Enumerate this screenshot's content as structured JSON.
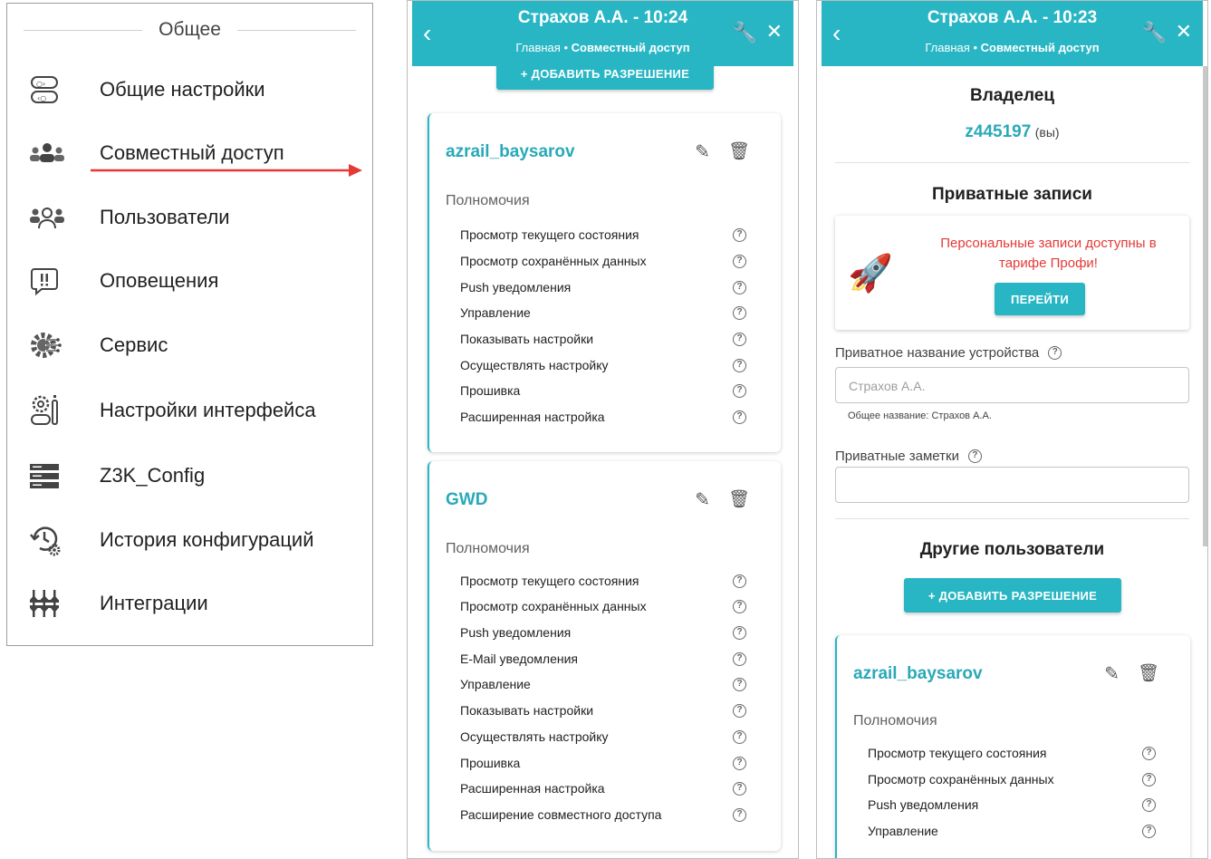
{
  "menu": {
    "header": "Общее",
    "items": [
      {
        "label": "Общие настройки",
        "icon": "toggles-icon"
      },
      {
        "label": "Совместный доступ",
        "icon": "shared-users-icon"
      },
      {
        "label": "Пользователи",
        "icon": "users-icon"
      },
      {
        "label": "Оповещения",
        "icon": "alert-icon"
      },
      {
        "label": "Сервис",
        "icon": "service-gear-icon"
      },
      {
        "label": "Настройки интерфейса",
        "icon": "interface-settings-icon"
      },
      {
        "label": "Z3K_Config",
        "icon": "server-icon"
      },
      {
        "label": "История конфигураций",
        "icon": "history-icon"
      },
      {
        "label": "Интеграции",
        "icon": "integrations-icon"
      }
    ]
  },
  "phone1": {
    "title": "Страхов А.А. - 10:24",
    "crumb_home": "Главная",
    "crumb_current": "Совместный доступ",
    "add_button": "+ ДОБАВИТЬ РАЗРЕШЕНИЕ",
    "cards": [
      {
        "user": "azrail_baysarov",
        "perm_head": "Полномочия",
        "perms": [
          "Просмотр текущего состояния",
          "Просмотр сохранённых данных",
          "Push уведомления",
          "Управление",
          "Показывать настройки",
          "Осуществлять настройку",
          "Прошивка",
          "Расширенная настройка"
        ]
      },
      {
        "user": "GWD",
        "perm_head": "Полномочия",
        "perms": [
          "Просмотр текущего состояния",
          "Просмотр сохранённых данных",
          "Push уведомления",
          "E-Mail уведомления",
          "Управление",
          "Показывать настройки",
          "Осуществлять настройку",
          "Прошивка",
          "Расширенная настройка",
          "Расширение совместного доступа"
        ]
      }
    ]
  },
  "phone2": {
    "title": "Страхов А.А. - 10:23",
    "crumb_home": "Главная",
    "crumb_current": "Совместный доступ",
    "owner_title": "Владелец",
    "owner_id": "z445197",
    "owner_you": "(вы)",
    "private_title": "Приватные записи",
    "promo_text": "Персональные записи доступны в тарифе Профи!",
    "promo_button": "ПЕРЕЙТИ",
    "device_name_label": "Приватное название устройства",
    "device_name_placeholder": "Страхов А.А.",
    "common_name": "Общее название: Страхов А.А.",
    "notes_label": "Приватные заметки",
    "others_title": "Другие пользователи",
    "add_button": "+ ДОБАВИТЬ РАЗРЕШЕНИЕ",
    "card": {
      "user": "azrail_baysarov",
      "perm_head": "Полномочия",
      "perms": [
        "Просмотр текущего состояния",
        "Просмотр сохранённых данных",
        "Push уведомления",
        "Управление"
      ]
    }
  },
  "colors": {
    "accent": "#29b6c4",
    "promo_red": "#e53935",
    "arrow_red": "#e53935"
  }
}
